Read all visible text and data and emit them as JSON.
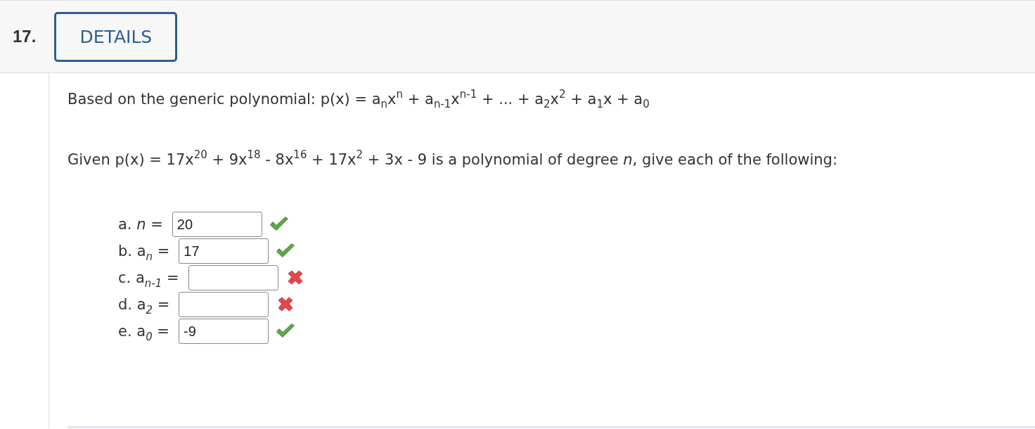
{
  "question": {
    "number": "17.",
    "details_button": "DETAILS"
  },
  "paragraphs": [
    "Based on the generic polynomial: p(x) = a$_{n}$x$^{n}$ + a$_{n-1}$x$^{n-1}$ + ... + a$_{2}$x$^{2}$ + a$_{1}$x + a$_{0}$",
    "Given p(x) = 17x$^{20}$ + 9x$^{18}$ - 8x$^{16}$ + 17x$^{2}$ + 3x - 9 is a polynomial of degree *n*, give each of the following:"
  ],
  "answers": [
    {
      "label": "a. *n* =",
      "value": "20",
      "correct": true
    },
    {
      "label": "b. a$_{n}$ =",
      "value": "17",
      "correct": true
    },
    {
      "label": "c. a$_{n-1}$ =",
      "correct": false
    },
    {
      "label": "d. a$_{2}$ =",
      "correct": false
    },
    {
      "label": "e. a$_{0}$ =",
      "value": "-9",
      "correct": true
    }
  ]
}
